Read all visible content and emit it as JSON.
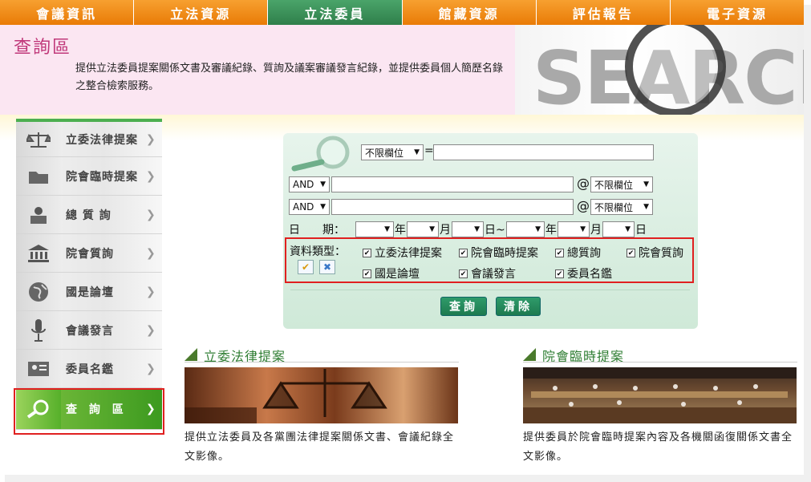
{
  "nav": {
    "tabs": [
      {
        "label": "會議資訊"
      },
      {
        "label": "立法資源"
      },
      {
        "label": "立法委員",
        "active": true
      },
      {
        "label": "館藏資源"
      },
      {
        "label": "評估報告"
      },
      {
        "label": "電子資源"
      }
    ]
  },
  "header": {
    "title": "查詢區",
    "description": "提供立法委員提案關係文書及審議紀錄、質詢及議案審議發言紀錄，並提供委員個人簡歷名錄之整合檢索服務。",
    "banner_text": "SEARCH"
  },
  "sidebar": {
    "items": [
      {
        "label": "立委法律提案",
        "icon": "scales-icon"
      },
      {
        "label": "院會臨時提案",
        "icon": "folder-icon"
      },
      {
        "label": "總 質 詢",
        "icon": "speaker-podium-icon"
      },
      {
        "label": "院會質詢",
        "icon": "government-building-icon"
      },
      {
        "label": "國是論壇",
        "icon": "globe-icon"
      },
      {
        "label": "會議發言",
        "icon": "microphone-icon"
      },
      {
        "label": "委員名鑑",
        "icon": "id-card-icon"
      },
      {
        "label": "查 詢 區",
        "icon": "search-icon",
        "active": true
      }
    ]
  },
  "search": {
    "field_select_1": "不限欄位",
    "equals": "=",
    "keyword_1": "",
    "op_2": "AND",
    "keyword_2": "",
    "at": "@",
    "field_select_2": "不限欄位",
    "op_3": "AND",
    "keyword_3": "",
    "field_select_3": "不限欄位",
    "date_label": "日　　期：",
    "year": "年",
    "month": "月",
    "day_to": "日~",
    "day": "日",
    "types_label": "資料類型：",
    "types": [
      {
        "label": "立委法律提案",
        "checked": true
      },
      {
        "label": "院會臨時提案",
        "checked": true
      },
      {
        "label": "總質詢",
        "checked": true
      },
      {
        "label": "院會質詢",
        "checked": true
      },
      {
        "label": "國是論壇",
        "checked": true
      },
      {
        "label": "會議發言",
        "checked": true
      },
      {
        "label": "委員名鑑",
        "checked": true
      }
    ],
    "query_button": "查詢",
    "clear_button": "清除"
  },
  "sections": [
    {
      "title": "立委法律提案",
      "description": "提供立法委員及各黨團法律提案關係文書、會議紀錄全文影像。"
    },
    {
      "title": "院會臨時提案",
      "description": "提供委員於院會臨時提案內容及各機關函復關係文書全文影像。"
    }
  ],
  "colors": {
    "nav_orange": "#ef8a12",
    "nav_active_green": "#3a8f57",
    "header_pink": "#fbe6f2",
    "title_magenta": "#c0387a",
    "panel_green": "#d8eee0",
    "button_green": "#1d7a4f",
    "highlight_red": "#e02020"
  }
}
